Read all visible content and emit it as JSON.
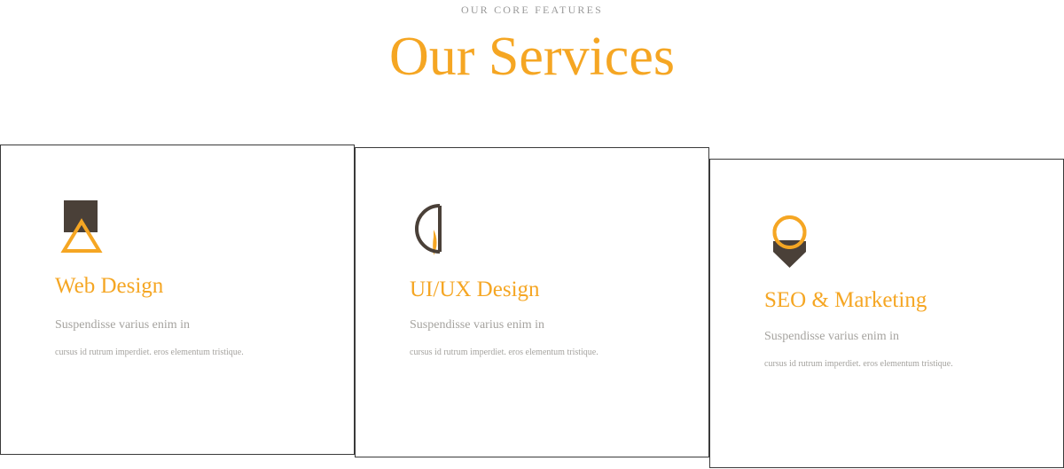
{
  "header": {
    "eyebrow": "OUR CORE FEATURES",
    "title": "Our Services"
  },
  "colors": {
    "accent": "#f5a623",
    "dark": "#4a4038",
    "muted_text": "#a5a39f",
    "border": "#3a3a3a"
  },
  "services": [
    {
      "icon": "square-triangle-icon",
      "title": "Web Design",
      "lead": "Suspendisse varius enim in",
      "body": "cursus id rutrum imperdiet. eros elementum tristique."
    },
    {
      "icon": "half-circles-icon",
      "title": "UI/UX Design",
      "lead": "Suspendisse varius enim in",
      "body": "cursus id rutrum imperdiet. eros elementum tristique."
    },
    {
      "icon": "ring-diamond-icon",
      "title": "SEO & Marketing",
      "lead": "Suspendisse varius enim in",
      "body": "cursus id rutrum imperdiet. eros elementum tristique."
    }
  ]
}
